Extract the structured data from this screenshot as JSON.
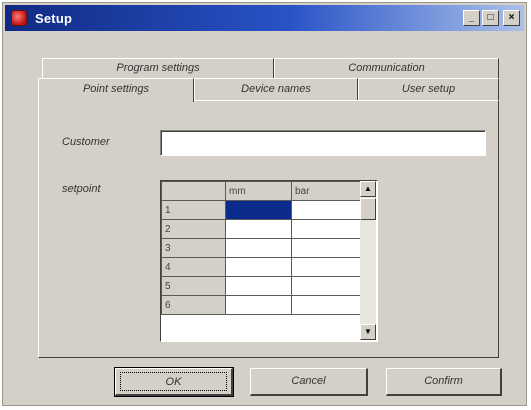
{
  "window": {
    "title": "Setup",
    "app_icon": "app-icon",
    "title_buttons": {
      "minimize": "_",
      "maximize": "□",
      "close": "×"
    }
  },
  "tabs": {
    "row1": [
      "Program settings",
      "Communication"
    ],
    "row2": [
      "Point settings",
      "Device names",
      "User setup"
    ],
    "active": "Point settings"
  },
  "form": {
    "customer_label": "Customer",
    "customer_value": "",
    "setpoint_label": "setpoint"
  },
  "grid": {
    "columns": [
      "",
      "mm",
      "bar"
    ],
    "rows": [
      "1",
      "2",
      "3",
      "4",
      "5",
      "6"
    ],
    "selected_cell": {
      "row": "1",
      "column": "mm"
    }
  },
  "buttons": {
    "ok": "OK",
    "cancel": "Cancel",
    "confirm": "Confirm"
  },
  "colors": {
    "title_bar": "#0f2a82",
    "dialog_face": "#d4d0c8",
    "selection": "#0a2a8c"
  }
}
